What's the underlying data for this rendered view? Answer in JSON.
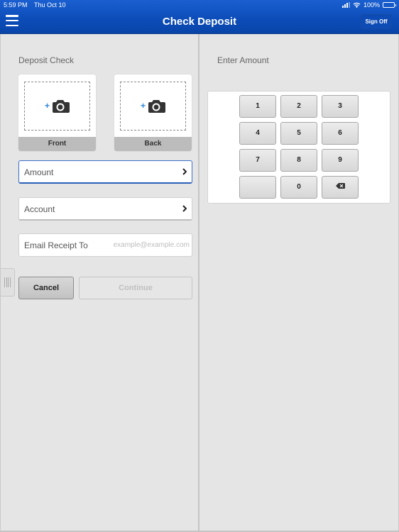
{
  "status_bar": {
    "time": "5:59 PM",
    "date": "Thu Oct 10",
    "battery": "100%",
    "battery_level": 1.0
  },
  "header": {
    "title": "Check Deposit",
    "sign_off_label": "Sign Off",
    "menu_icon": "hamburger-menu-icon"
  },
  "left_pane": {
    "section_label": "Deposit Check",
    "photos": [
      {
        "caption": "Front",
        "icon": "add-camera-icon"
      },
      {
        "caption": "Back",
        "icon": "add-camera-icon"
      }
    ],
    "fields": {
      "amount_label": "Amount",
      "account_label": "Account",
      "email_label": "Email Receipt To",
      "email_value": "",
      "email_placeholder": "example@example.com"
    },
    "buttons": {
      "cancel": "Cancel",
      "continue": "Continue"
    }
  },
  "right_pane": {
    "section_label": "Enter Amount",
    "keys": [
      "1",
      "2",
      "3",
      "4",
      "5",
      "6",
      "7",
      "8",
      "9",
      "",
      "0",
      "backspace"
    ]
  },
  "colors": {
    "header_blue": "#0c4cb8",
    "plus_blue": "#2a85e0",
    "active_border": "#3a6ec4"
  }
}
